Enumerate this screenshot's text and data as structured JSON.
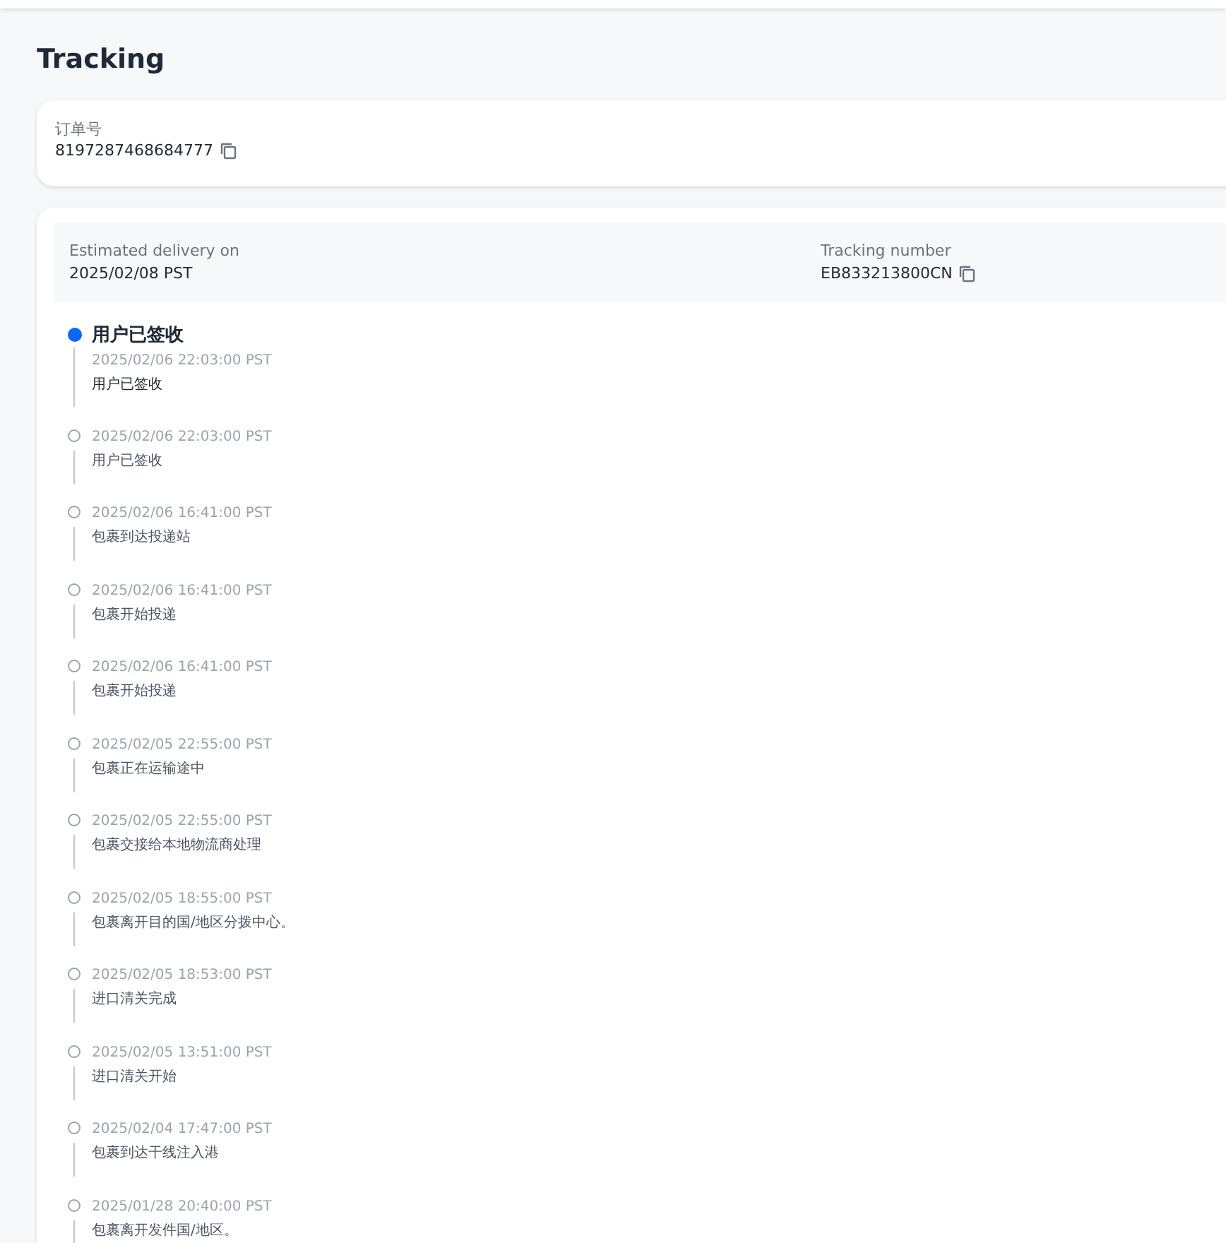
{
  "page_title": "Tracking",
  "order": {
    "label": "订单号",
    "number": "8197287468684777"
  },
  "summary": {
    "delivery_label": "Estimated delivery on",
    "delivery_value": "2025/02/08 PST",
    "tracking_label": "Tracking number",
    "tracking_value": "EB833213800CN"
  },
  "events": [
    {
      "current": true,
      "title": "用户已签收",
      "time": "2025/02/06 22:03:00 PST",
      "description": "用户已签收"
    },
    {
      "current": false,
      "time": "2025/02/06 22:03:00 PST",
      "description": "用户已签收"
    },
    {
      "current": false,
      "time": "2025/02/06 16:41:00 PST",
      "description": "包裹到达投递站"
    },
    {
      "current": false,
      "time": "2025/02/06 16:41:00 PST",
      "description": "包裹开始投递"
    },
    {
      "current": false,
      "time": "2025/02/06 16:41:00 PST",
      "description": "包裹开始投递"
    },
    {
      "current": false,
      "time": "2025/02/05 22:55:00 PST",
      "description": "包裹正在运输途中"
    },
    {
      "current": false,
      "time": "2025/02/05 22:55:00 PST",
      "description": "包裹交接给本地物流商处理"
    },
    {
      "current": false,
      "time": "2025/02/05 18:55:00 PST",
      "description": "包裹离开目的国/地区分拨中心。"
    },
    {
      "current": false,
      "time": "2025/02/05 18:53:00 PST",
      "description": "进口清关完成"
    },
    {
      "current": false,
      "time": "2025/02/05 13:51:00 PST",
      "description": "进口清关开始"
    },
    {
      "current": false,
      "time": "2025/02/04 17:47:00 PST",
      "description": "包裹到达干线注入港"
    },
    {
      "current": false,
      "time": "2025/01/28 20:40:00 PST",
      "description": "包裹离开发件国/地区。"
    }
  ]
}
